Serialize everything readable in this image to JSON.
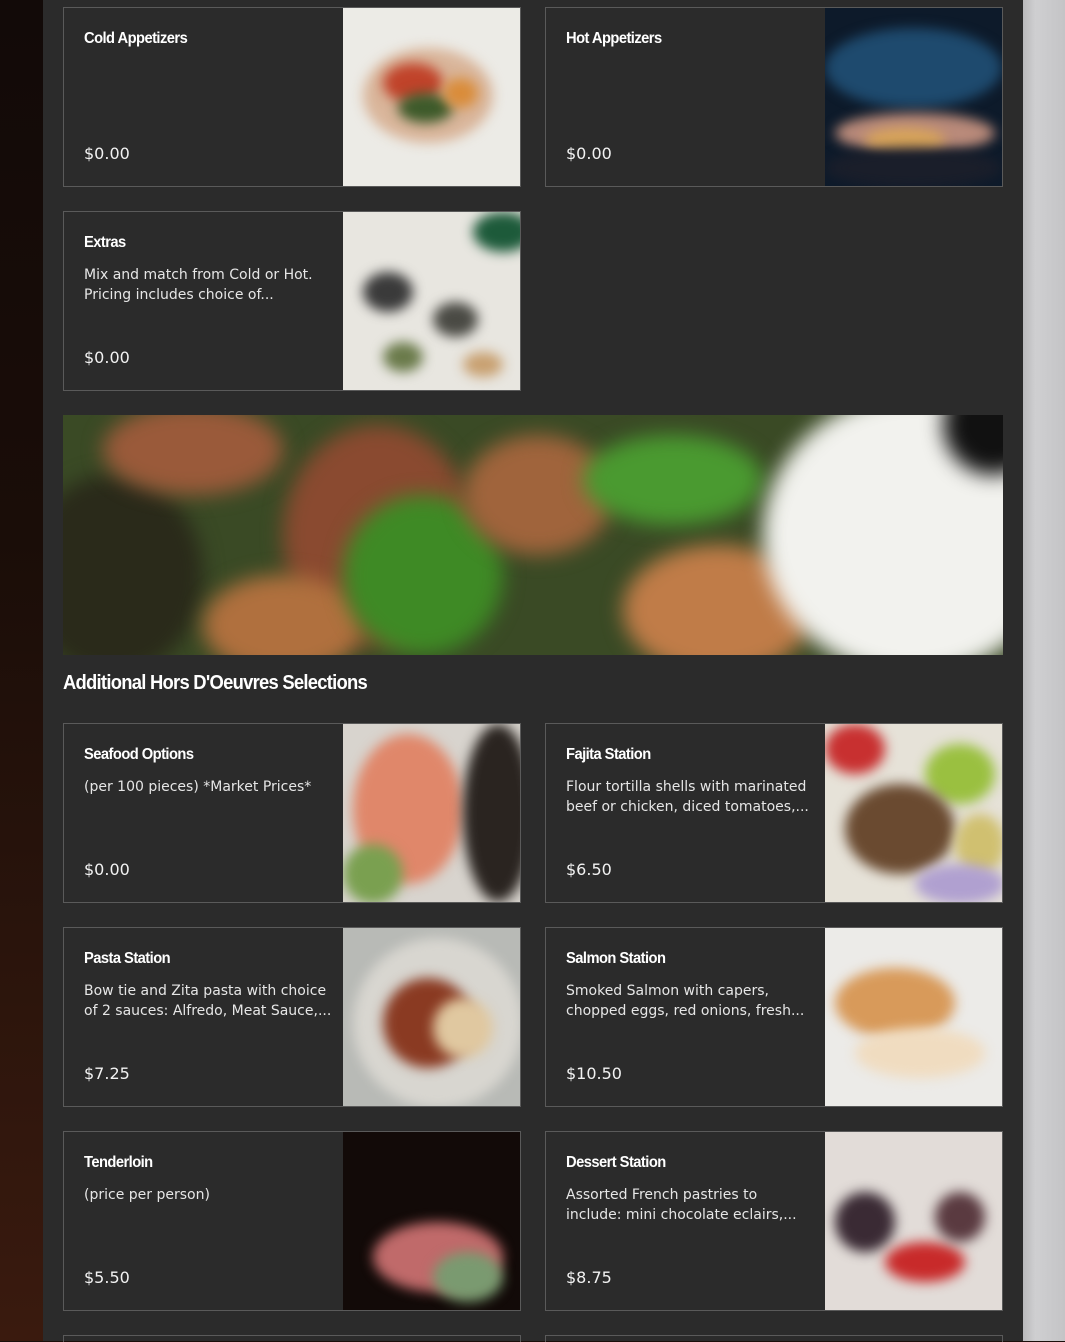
{
  "colors": {
    "panel": "#2b2b2b",
    "border": "#5a5a5a",
    "text": "#ffffff"
  },
  "top_cards": [
    {
      "title": "Cold Appetizers",
      "desc": [],
      "price": "$0.00",
      "image": "cold-appetizers-image"
    },
    {
      "title": "Hot Appetizers",
      "desc": [],
      "price": "$0.00",
      "image": "hot-appetizers-image"
    },
    {
      "title": "Extras",
      "desc": [
        "Mix and match from Cold or Hot.",
        "Pricing includes choice of..."
      ],
      "price": "$0.00",
      "image": "extras-image"
    }
  ],
  "banner": {
    "image": "hors-doeuvres-banner-image"
  },
  "section": {
    "title": "Additional Hors D'Oeuvres Selections"
  },
  "cards": [
    {
      "title": "Seafood Options",
      "desc": [
        "(per 100 pieces) *Market Prices*"
      ],
      "price": "$0.00",
      "image": "seafood-image"
    },
    {
      "title": "Fajita Station",
      "desc": [
        "Flour tortilla shells with marinated",
        "beef or chicken, diced tomatoes,..."
      ],
      "price": "$6.50",
      "image": "fajita-image"
    },
    {
      "title": "Pasta Station",
      "desc": [
        "Bow tie and Zita pasta with choice",
        "of 2 sauces: Alfredo, Meat Sauce,..."
      ],
      "price": "$7.25",
      "image": "pasta-image"
    },
    {
      "title": "Salmon Station",
      "desc": [
        "Smoked Salmon with capers,",
        "chopped eggs, red onions, fresh..."
      ],
      "price": "$10.50",
      "image": "salmon-image"
    },
    {
      "title": "Tenderloin",
      "desc": [
        "(price per person)"
      ],
      "price": "$5.50",
      "image": "tenderloin-image"
    },
    {
      "title": "Dessert Station",
      "desc": [
        "Assorted French pastries to",
        "include: mini chocolate eclairs,..."
      ],
      "price": "$8.75",
      "image": "dessert-image"
    }
  ]
}
